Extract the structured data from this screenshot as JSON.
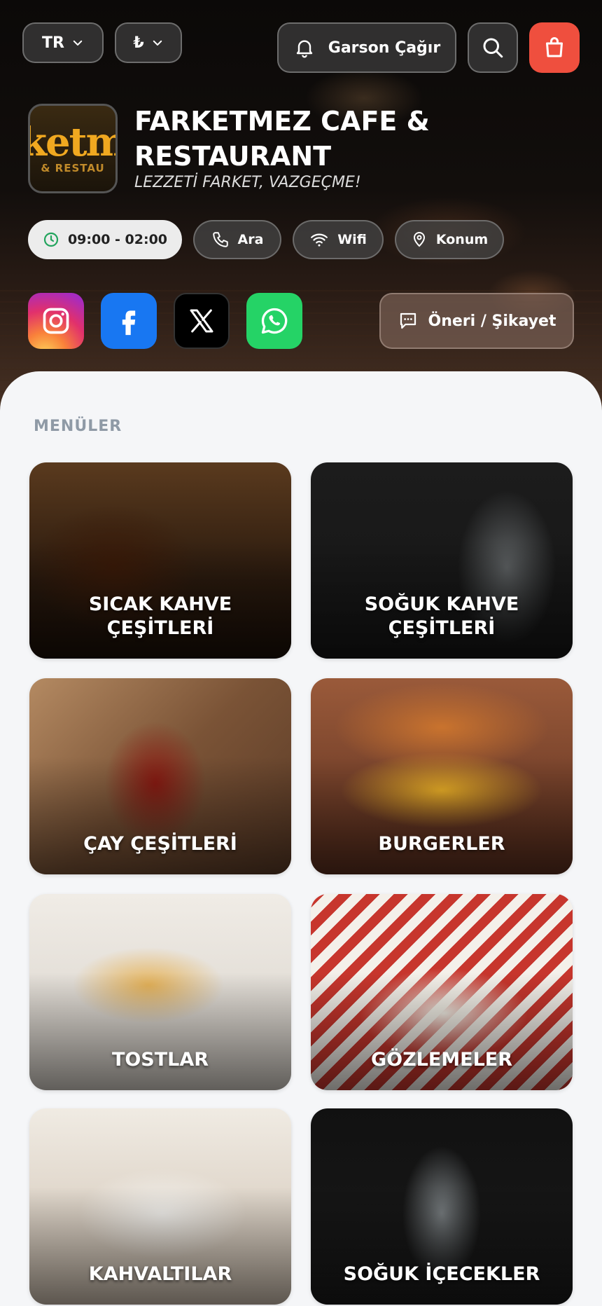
{
  "header": {
    "language": "TR",
    "currency": "₺",
    "waiter_button": "Garson Çağır",
    "icons": {
      "search": "search-icon",
      "cart": "shopping-bag-icon",
      "bell": "bell-icon",
      "chevron": "chevron-down-icon"
    }
  },
  "restaurant": {
    "logo_text_line1": "ketm",
    "logo_text_line2": "& RESTAU",
    "name": "FARKETMEZ CAFE & RESTAURANT",
    "slogan": "LEZZETİ FARKET, VAZGEÇME!"
  },
  "info_chips": {
    "hours": "09:00 - 02:00",
    "call": "Ara",
    "wifi": "Wifi",
    "location": "Konum"
  },
  "social": {
    "instagram": "instagram-icon",
    "facebook": "facebook-icon",
    "x": "x-icon",
    "whatsapp": "whatsapp-icon",
    "feedback": "Öneri / Şikayet"
  },
  "colors": {
    "accent": "#ef4f3e",
    "hours_icon": "#22a45d",
    "section_label": "#8f9aa6"
  },
  "menus": {
    "section_title": "MENÜLER",
    "items": [
      {
        "line1": "SICAK KAHVE",
        "line2": "ÇEŞİTLERİ"
      },
      {
        "line1": "SOĞUK KAHVE",
        "line2": "ÇEŞİTLERİ"
      },
      {
        "line1": "ÇAY ÇEŞİTLERİ",
        "line2": ""
      },
      {
        "line1": "BURGERLER",
        "line2": ""
      },
      {
        "line1": "TOSTLAR",
        "line2": ""
      },
      {
        "line1": "GÖZLEMELER",
        "line2": ""
      },
      {
        "line1": "KAHVALTILAR",
        "line2": ""
      },
      {
        "line1": "SOĞUK İÇECEKLER",
        "line2": ""
      }
    ]
  }
}
